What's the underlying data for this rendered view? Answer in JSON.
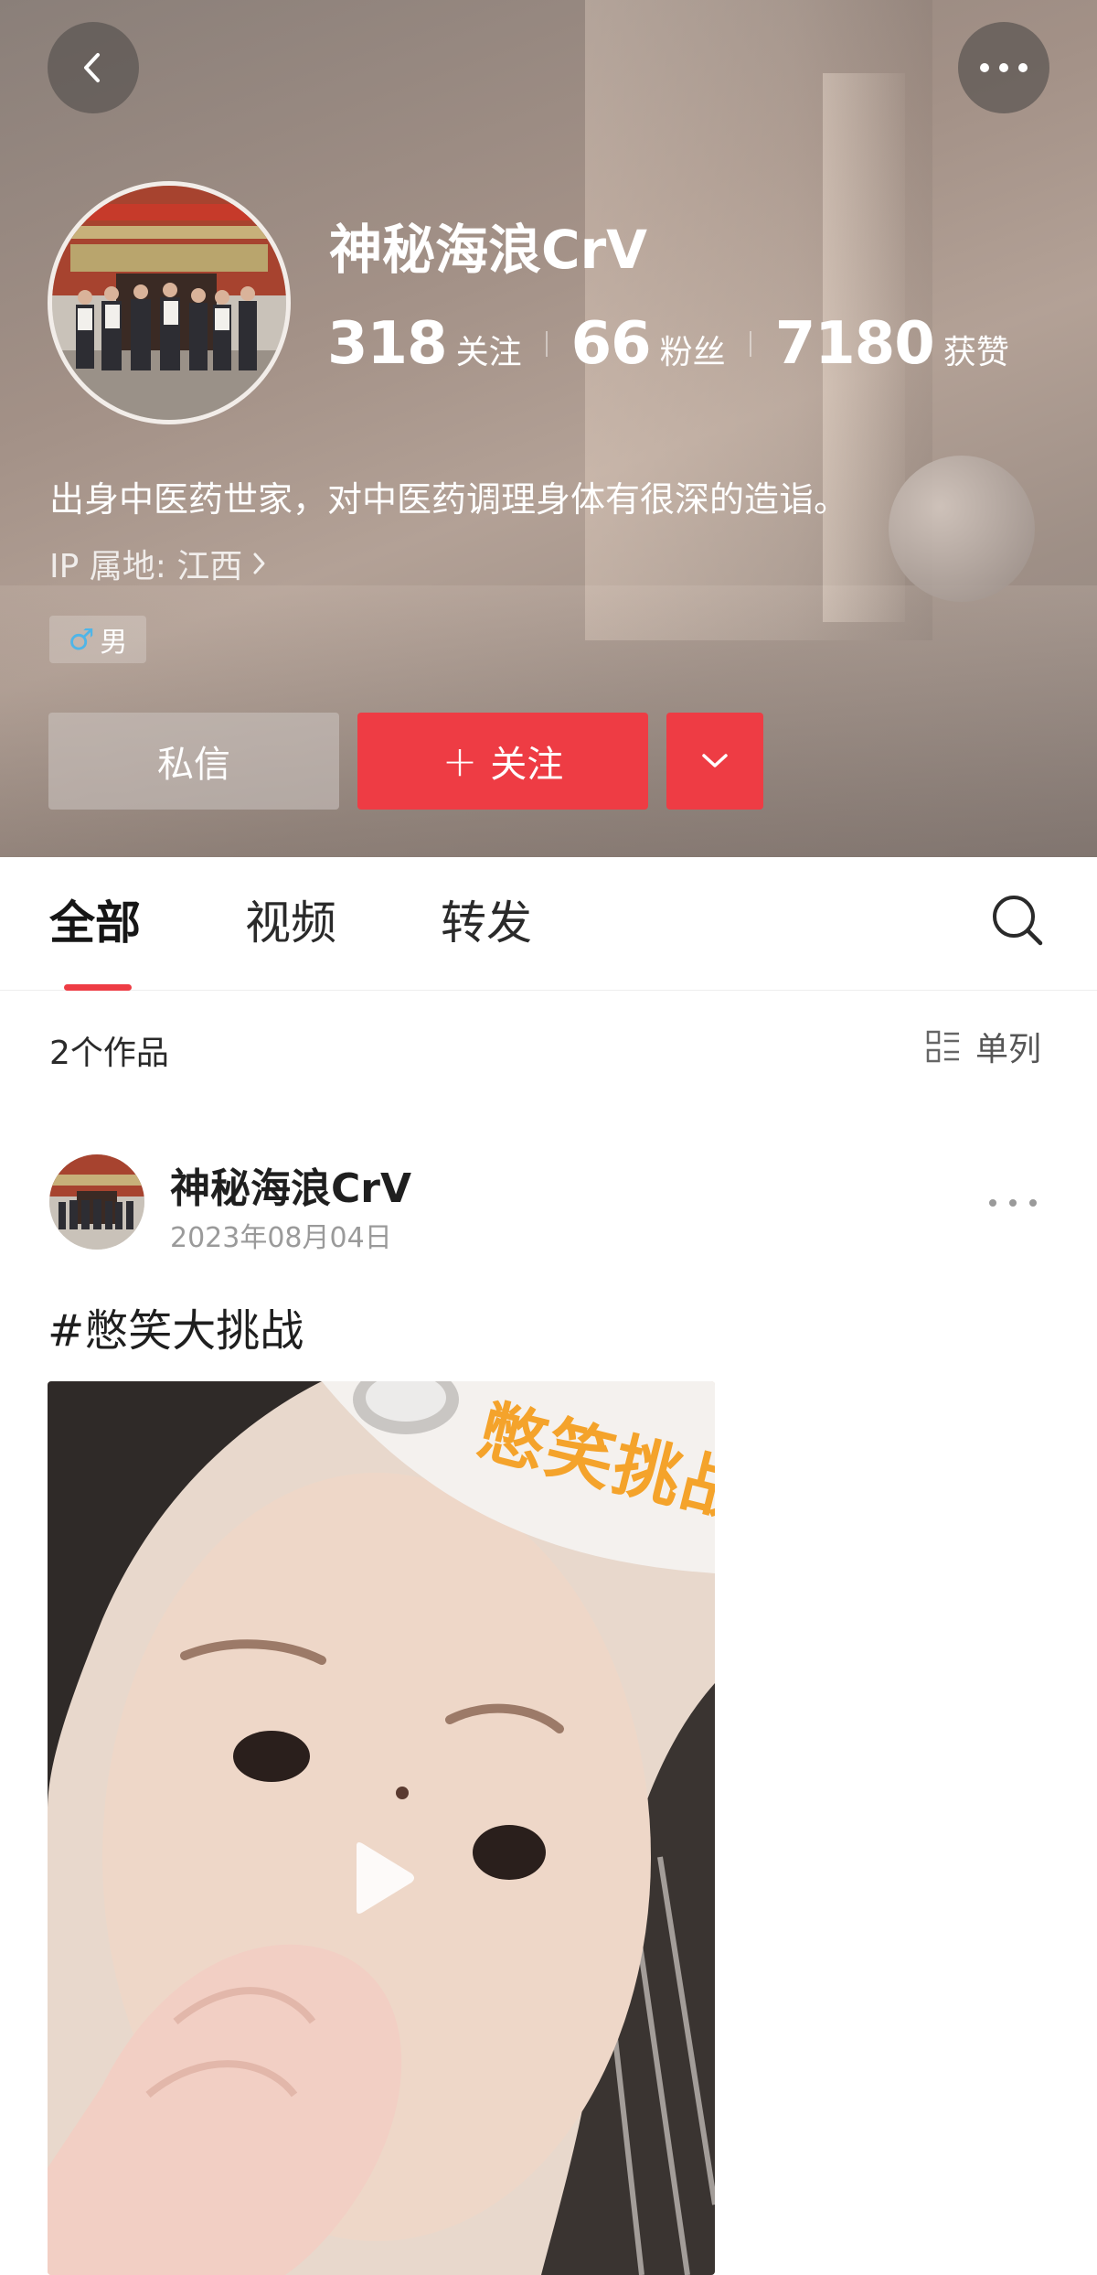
{
  "header": {
    "username": "神秘海浪CrV",
    "stats": [
      {
        "value": "318",
        "label": "关注"
      },
      {
        "value": "66",
        "label": "粉丝"
      },
      {
        "value": "7180",
        "label": "获赞"
      }
    ],
    "bio": "出身中医药世家，对中医药调理身体有很深的造诣。",
    "ip_location": "IP 属地: 江西",
    "gender": "男",
    "gender_symbol": "♂",
    "buttons": {
      "message": "私信",
      "follow": "关注",
      "follow_icon": "+"
    }
  },
  "tabs": [
    {
      "label": "全部",
      "active": true
    },
    {
      "label": "视频",
      "active": false
    },
    {
      "label": "转发",
      "active": false
    }
  ],
  "works": {
    "count_label": "2个作品",
    "view_mode_label": "单列"
  },
  "post": {
    "username": "神秘海浪CrV",
    "date": "2023年08月04日",
    "text": "#憋笑大挑战",
    "video_sticker_text": "憋笑挑战"
  },
  "colors": {
    "accent": "#ee3c44",
    "gender_male": "#4fb5e8"
  },
  "icons": {
    "back": "chevron-left-icon",
    "more": "more-horizontal-icon",
    "dropdown": "chevron-down-icon",
    "search": "search-icon",
    "view": "list-view-icon",
    "play": "play-icon"
  }
}
